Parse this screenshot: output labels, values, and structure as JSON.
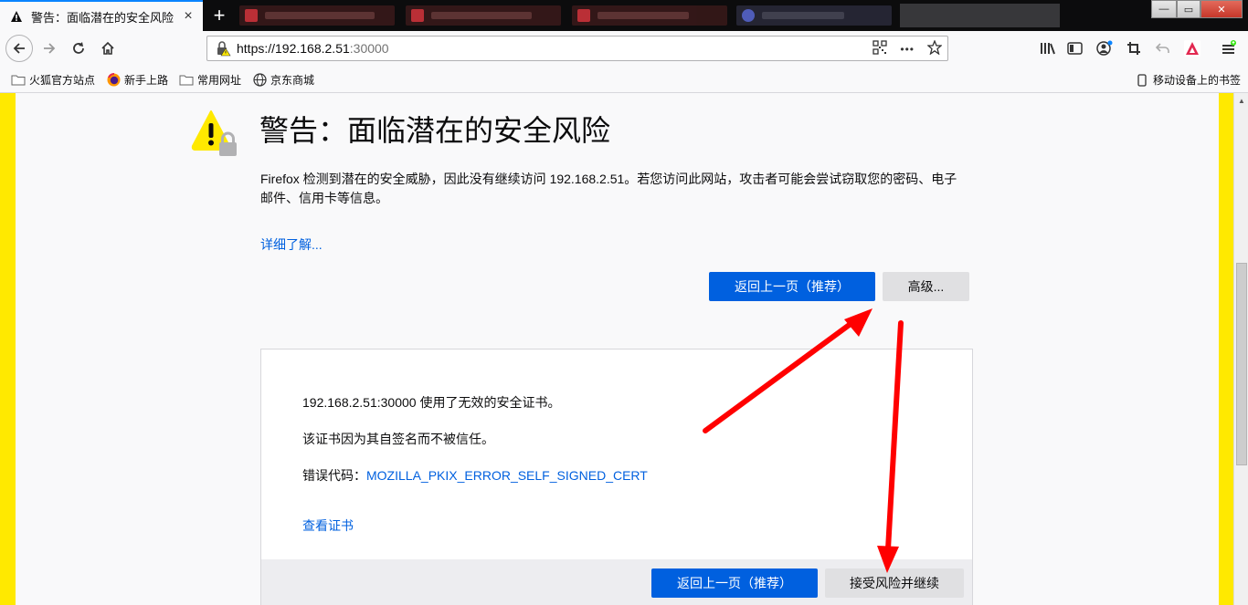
{
  "tab": {
    "title": "警告：面临潜在的安全风险",
    "close": "×",
    "new_tab": "+"
  },
  "window": {
    "minimize": "—",
    "maximize": "▭",
    "close": "✕"
  },
  "nav": {
    "url_host": "https://192.168.2.51",
    "url_port": ":30000",
    "menu_dots": "•••"
  },
  "bookmarks": {
    "items": [
      "火狐官方站点",
      "新手上路",
      "常用网址",
      "京东商城"
    ],
    "mobile": "移动设备上的书签"
  },
  "page": {
    "title": "警告：面临潜在的安全风险",
    "description": "Firefox 检测到潜在的安全威胁，因此没有继续访问 192.168.2.51。若您访问此网站，攻击者可能会尝试窃取您的密码、电子邮件、信用卡等信息。",
    "learn_more": "详细了解...",
    "go_back": "返回上一页（推荐）",
    "advanced": "高级..."
  },
  "advanced_panel": {
    "line1": "192.168.2.51:30000 使用了无效的安全证书。",
    "line2": "该证书因为其自签名而不被信任。",
    "error_label": "错误代码：",
    "error_code": "MOZILLA_PKIX_ERROR_SELF_SIGNED_CERT",
    "view_cert": "查看证书",
    "go_back": "返回上一页（推荐）",
    "accept": "接受风险并继续"
  },
  "colors": {
    "accent": "#0060df",
    "warning_stripe": "#ffe900",
    "annotation_arrow": "#ff0000"
  }
}
